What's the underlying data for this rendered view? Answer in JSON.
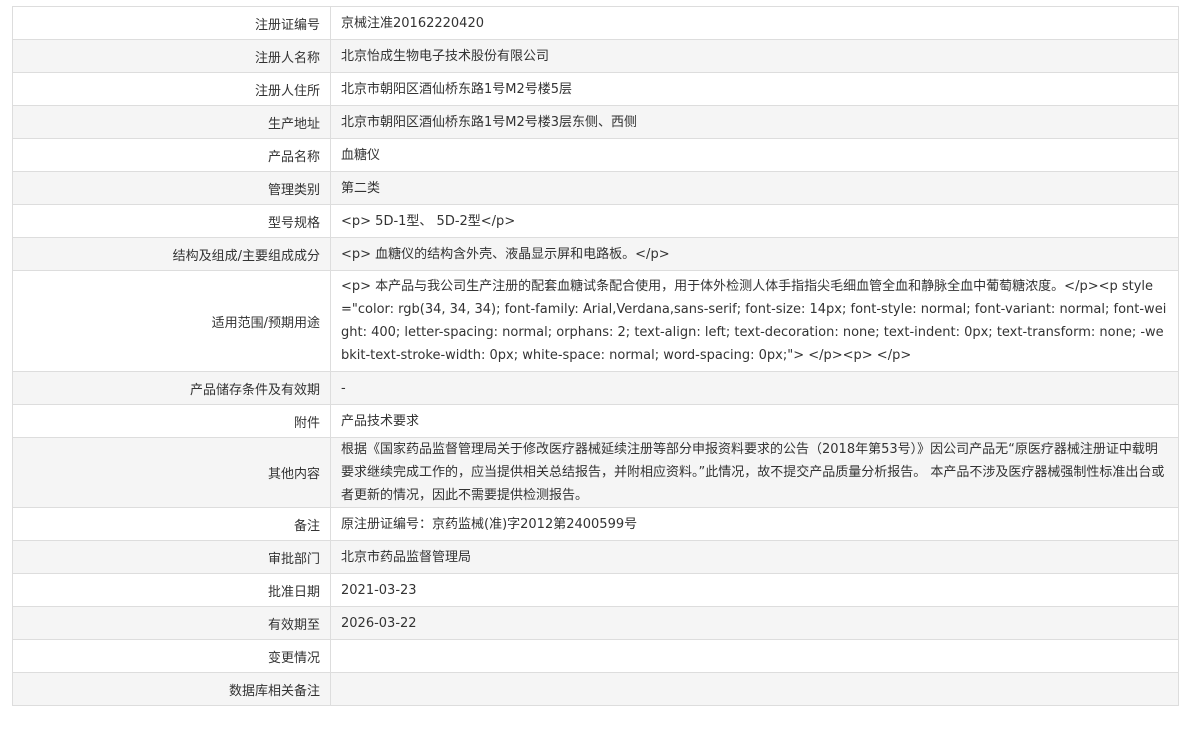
{
  "rows": [
    {
      "label": "注册证编号",
      "value": "京械注准20162220420"
    },
    {
      "label": "注册人名称",
      "value": "北京怡成生物电子技术股份有限公司"
    },
    {
      "label": "注册人住所",
      "value": "北京市朝阳区酒仙桥东路1号M2号楼5层"
    },
    {
      "label": "生产地址",
      "value": "北京市朝阳区酒仙桥东路1号M2号楼3层东侧、西侧"
    },
    {
      "label": "产品名称",
      "value": "血糖仪"
    },
    {
      "label": "管理类别",
      "value": "第二类"
    },
    {
      "label": "型号规格",
      "value": "<p> 5D-1型、 5D-2型</p>"
    },
    {
      "label": "结构及组成/主要组成成分",
      "value": "<p> 血糖仪的结构含外壳、液晶显示屏和电路板。</p>"
    },
    {
      "label": "适用范围/预期用途",
      "value": "<p> 本产品与我公司生产注册的配套血糖试条配合使用，用于体外检测人体手指指尖毛细血管全血和静脉全血中葡萄糖浓度。</p><p style=\"color: rgb(34, 34, 34); font-family: Arial,Verdana,sans-serif; font-size: 14px; font-style: normal; font-variant: normal; font-weight: 400; letter-spacing: normal; orphans: 2; text-align: left; text-decoration: none; text-indent: 0px; text-transform: none; -webkit-text-stroke-width: 0px; white-space: normal; word-spacing: 0px;\"> </p><p> </p>"
    },
    {
      "label": "产品储存条件及有效期",
      "value": "-"
    },
    {
      "label": "附件",
      "value": "产品技术要求"
    },
    {
      "label": "其他内容",
      "value": "根据《国家药品监督管理局关于修改医疗器械延续注册等部分申报资料要求的公告（2018年第53号）》因公司产品无“原医疗器械注册证中载明要求继续完成工作的，应当提供相关总结报告，并附相应资料。”此情况，故不提交产品质量分析报告。 本产品不涉及医疗器械强制性标准出台或者更新的情况，因此不需要提供检测报告。"
    },
    {
      "label": "备注",
      "value": "原注册证编号：京药监械(准)字2012第2400599号"
    },
    {
      "label": "审批部门",
      "value": "北京市药品监督管理局"
    },
    {
      "label": "批准日期",
      "value": "2021-03-23"
    },
    {
      "label": "有效期至",
      "value": "2026-03-22"
    },
    {
      "label": "变更情况",
      "value": ""
    },
    {
      "label": "数据库相关备注",
      "value": ""
    }
  ]
}
